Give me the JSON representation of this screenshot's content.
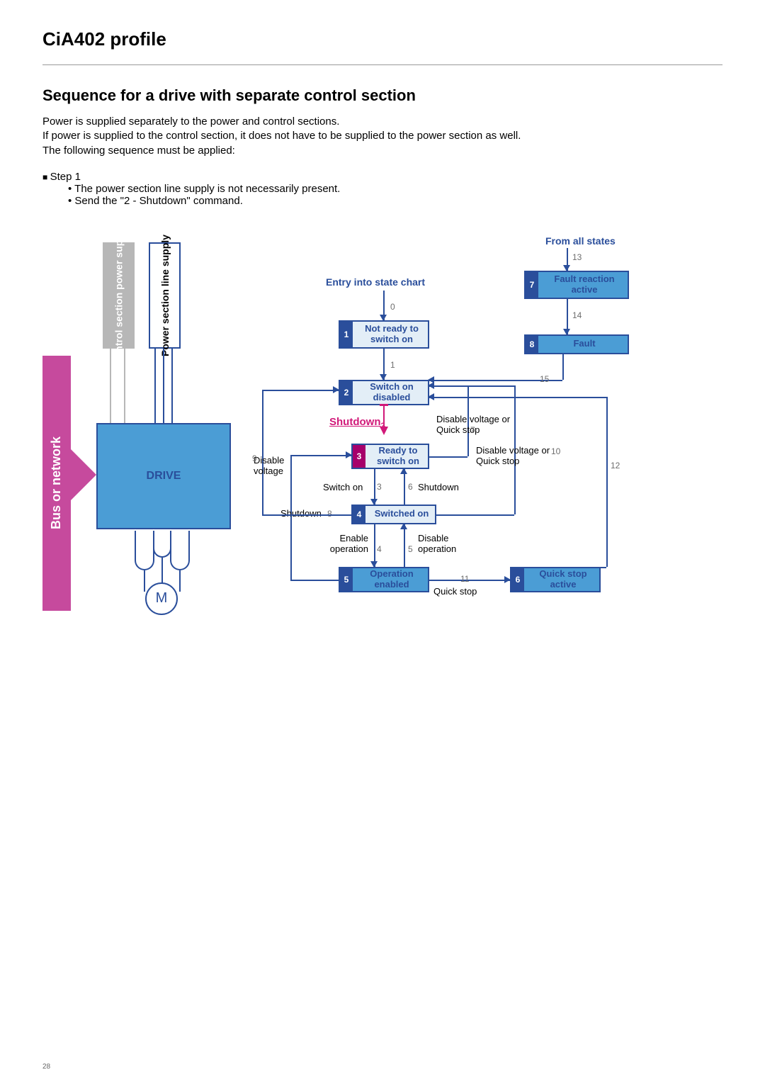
{
  "page_number": "28",
  "title": "CiA402 profile",
  "section_heading": "Sequence for a drive with separate control section",
  "intro_lines": {
    "l1": "Power is supplied separately to the power and control sections.",
    "l2": "If power is supplied to the control section, it does not have to be supplied to the power section as well.",
    "l3": "The following sequence must be applied:"
  },
  "step": {
    "label": "Step 1",
    "bullets": {
      "b1": "The power section line supply is not necessarily present.",
      "b2": "Send the \"2 - Shutdown\" command."
    }
  },
  "diagram": {
    "bus_label": "Bus or network",
    "control_supply": "Control section power supply",
    "power_supply": "Power section line supply",
    "drive": "DRIVE",
    "motor": "M",
    "entry_label": "Entry into state chart",
    "from_all_states": "From all states",
    "shutdown_cmd": "Shutdown",
    "states": {
      "s1": {
        "num": "1",
        "text": "Not ready to switch on"
      },
      "s2": {
        "num": "2",
        "text": "Switch on disabled"
      },
      "s3": {
        "num": "3",
        "text": "Ready to switch on"
      },
      "s4": {
        "num": "4",
        "text": "Switched on"
      },
      "s5": {
        "num": "5",
        "text": "Operation enabled"
      },
      "s6": {
        "num": "6",
        "text": "Quick stop active"
      },
      "s7": {
        "num": "7",
        "text": "Fault reaction active"
      },
      "s8": {
        "num": "8",
        "text": "Fault"
      }
    },
    "transitions": {
      "t0": "0",
      "t1": "1",
      "t2": "2",
      "t3": "3",
      "t4": "4",
      "t5": "5",
      "t6": "6",
      "t7": "7",
      "t8": "8",
      "t9": "9",
      "t10": "10",
      "t11": "11",
      "t12": "12",
      "t13": "13",
      "t14": "14",
      "t15": "15"
    },
    "edge_labels": {
      "switch_on": "Switch on",
      "shutdown_8": "Shutdown",
      "shutdown_6": "Shutdown",
      "enable_op": "Enable operation",
      "disable_op": "Disable operation",
      "disable_voltage_7": "Disable voltage or Quick stop",
      "disable_voltage_10": "Disable voltage or Quick stop",
      "disable_voltage_9": "Disable voltage",
      "quick_stop": "Quick stop"
    }
  }
}
